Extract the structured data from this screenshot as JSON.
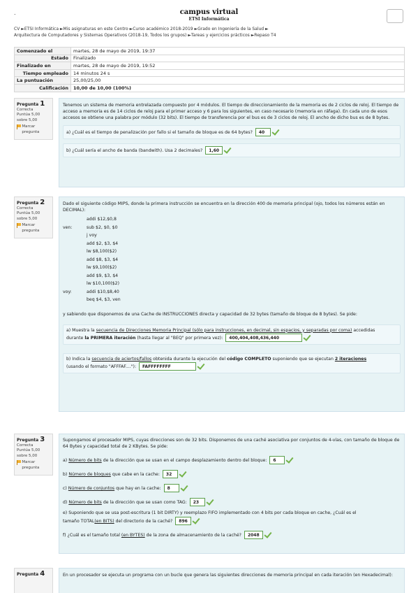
{
  "header": {
    "dot": ".",
    "site_title": "campus virtual",
    "site_subtitle": "ETSI Informática"
  },
  "breadcrumb": {
    "line1": "CV ►ETSI Informática ►Mis asignaturas en este Centro ►Curso académico 2018-2019 ►Grado en Ingeniería de la Salud ►",
    "line2": "Arquitectura de Computadores y Sistemas Operativos (2018-19, Todos los grupos) ►Tareas y ejercicios prácticos ►Repaso T4"
  },
  "summary": [
    {
      "label": "Comenzado el",
      "value": "martes, 28 de mayo de 2019, 19:37",
      "align": "left"
    },
    {
      "label": "Estado",
      "value": "Finalizado",
      "align": "right"
    },
    {
      "label": "Finalizado en",
      "value": "martes, 28 de mayo de 2019, 19:52",
      "align": "left"
    },
    {
      "label": "Tiempo empleado",
      "value": "14 minutos 24 s",
      "align": "right"
    },
    {
      "label": "La puntuación",
      "value": "25,00/25,00",
      "align": "left"
    },
    {
      "label": "Calificación",
      "value": "10,00 de 10,00 (100%)",
      "align": "right"
    }
  ],
  "q1": {
    "label": "Pregunta",
    "number": "1",
    "status": "Correcta",
    "score": "Puntúa 5,00 sobre 5,00",
    "flag_label": "Marcar pregunta",
    "text": "Tenemos un sistema de memoria entrelazada compuesto por 4 módulos. El tiempo de direccionamiento de la memoria es de 2 ciclos de reloj. El tiempo de acceso a memoria es de 14 ciclos de reloj para el primer acceso y 6 para los siguientes, en caso necesario (memoria en ráfaga). En cada uno de esos accesos se obtiene una palabra por módulo (32 bits). El tiempo de transferencia por el bus es de 3 ciclos de reloj. El ancho de dicho bus es de 8 bytes.",
    "a_text": "a) ¿Cuál es el tiempo de penalización por fallo si el tamaño de bloque es de 64 bytes?",
    "a_answer": "40",
    "b_text": "b) ¿Cuál sería el ancho de banda (bandwith). Usa 2 decimales?",
    "b_answer": "1,60"
  },
  "q2": {
    "label": "Pregunta",
    "number": "2",
    "status": "Correcta",
    "score": "Puntúa 5,00 sobre 5,00",
    "flag_label": "Marcar pregunta",
    "intro": "Dado el siguiente código MIPS, donde la primera instrucción se encuentra en la dirección 400 de memoria principal (ojo, todos los números están en DECIMAL):",
    "code": [
      {
        "label": "",
        "instr": "addi $12,$0,8"
      },
      {
        "label": "ven:",
        "instr": "sub $2, $0, $0"
      },
      {
        "label": "",
        "instr": "j voy"
      },
      {
        "label": "",
        "instr": "add $2, $3, $4"
      },
      {
        "label": "",
        "instr": "lw $8,100($2)"
      },
      {
        "label": "",
        "instr": "add $8, $3, $4"
      },
      {
        "label": "",
        "instr": "lw $9,100($2)"
      },
      {
        "label": "",
        "instr": "add $9, $3, $4"
      },
      {
        "label": "",
        "instr": "lw $10,100($2)"
      },
      {
        "label": "voy:",
        "instr": "addi $10,$8,40"
      },
      {
        "label": "",
        "instr": "beq $4, $3, ven"
      }
    ],
    "cache_text": "y sabiendo que disponemos de una Cache de INSTRUCCIONES directa y capacidad de 32 bytes (tamaño de bloque de 8 bytes). Se pide:",
    "a_pre": "a) Muestra la ",
    "a_u": "secuencia de Direcciones Memoria Principal (sólo para instrucciones, en decimal, sin espacios, y separadas por coma)",
    "a_post": " accedidas",
    "a_line2_pre": "durante ",
    "a_bold": "la PRIMERA iteración",
    "a_line2_post": " (hasta llegar al \"BEQ\" por primera vez):",
    "a_answer": "400,404,408,436,440",
    "b_pre": "b) Indica la ",
    "b_u": "secuencia de aciertos/fallos",
    "b_mid": " obtenida durante la ejecución del ",
    "b_bold": "código COMPLETO",
    "b_mid2": " suponiendo que se ejecutan ",
    "b_bold_u": "2 iteraciones",
    "b_line2": "(usando el formato \"AFFFAF....\"):",
    "b_answer": "FAFFFFFFFF"
  },
  "q3": {
    "label": "Pregunta",
    "number": "3",
    "status": "Correcta",
    "score": "Puntúa 5,00 sobre 5,00",
    "flag_label": "Marcar pregunta",
    "intro": "Supongamos el procesador MIPS, cuyas direcciones son de 32 bits. Disponemos de una caché asociativa por conjuntos de 4-vías, con tamaño de bloque de 64 Bytes y capacidad total de 2 KBytes. Se pide:",
    "a_pre": "a) ",
    "a_u": "Número de bits",
    "a_post": " de la dirección que se usan en el campo desplazamiento dentro del bloque:",
    "a_answer": "6",
    "b_pre": "b) ",
    "b_u": "Número de bloques",
    "b_post": " que cabe en la cache:",
    "b_answer": "32",
    "c_pre": "c) ",
    "c_u": "Número de conjuntos",
    "c_post": " que hay en la cache:",
    "c_answer": "8",
    "d_pre": "d) ",
    "d_u": "Número de bits",
    "d_post": " de la dirección que se usan como TAG:",
    "d_answer": "23",
    "e_line1": "e) Suponiendo que se usa post-escritura (1 bit DIRTY) y reemplazo FIFO implementado con 4 bits por cada bloque en cache, ¿Cuál es el",
    "e_pre": "tamaño TOTAL",
    "e_u": "(en BITS)",
    "e_post": " del directorio de la caché?",
    "e_answer": "896",
    "f_pre": "f) ¿Cuál es el tamaño total ",
    "f_u": "(en BYTES)",
    "f_post": " de la zona de almacenamiento de la caché?",
    "f_answer": "2048"
  },
  "q4": {
    "label": "Pregunta",
    "number": "4",
    "text": "En un procesador se ejecuta un programa con un bucle que genera las siguientes direcciones de memoria principal en cada iteración (en Hexadecimal):"
  }
}
